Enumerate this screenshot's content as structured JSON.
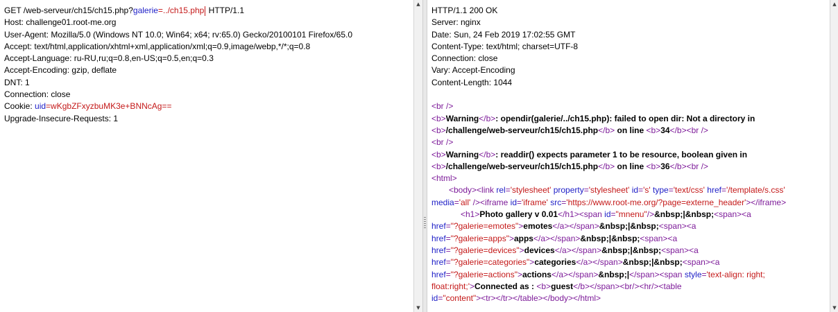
{
  "request": {
    "lines": [
      [
        {
          "t": "GET /web-serveur/ch15/ch15.php?",
          "c": "t"
        },
        {
          "t": "galerie",
          "c": "blue"
        },
        {
          "t": "=../ch15.php",
          "c": "red"
        },
        {
          "t": "",
          "c": "caret"
        },
        {
          "t": " HTTP/1.1",
          "c": "t"
        }
      ],
      [
        {
          "t": "Host: challenge01.root-me.org",
          "c": "t"
        }
      ],
      [
        {
          "t": "User-Agent: Mozilla/5.0 (Windows NT 10.0; Win64; x64; rv:65.0) Gecko/20100101 Firefox/65.0",
          "c": "t"
        }
      ],
      [
        {
          "t": "Accept: text/html,application/xhtml+xml,application/xml;q=0.9,image/webp,*/*;q=0.8",
          "c": "t"
        }
      ],
      [
        {
          "t": "Accept-Language: ru-RU,ru;q=0.8,en-US;q=0.5,en;q=0.3",
          "c": "t"
        }
      ],
      [
        {
          "t": "Accept-Encoding: gzip, deflate",
          "c": "t"
        }
      ],
      [
        {
          "t": "DNT: 1",
          "c": "t"
        }
      ],
      [
        {
          "t": "Connection: close",
          "c": "t"
        }
      ],
      [
        {
          "t": "Cookie: ",
          "c": "t"
        },
        {
          "t": "uid",
          "c": "blue"
        },
        {
          "t": "=wKgbZFxyzbuMK3e+BNNcAg==",
          "c": "red"
        }
      ],
      [
        {
          "t": "Upgrade-Insecure-Requests: 1",
          "c": "t"
        }
      ]
    ]
  },
  "response": {
    "lines": [
      [
        {
          "t": "HTTP/1.1 200 OK",
          "c": "t"
        }
      ],
      [
        {
          "t": "Server: nginx",
          "c": "t"
        }
      ],
      [
        {
          "t": "Date: Sun, 24 Feb 2019 17:02:55 GMT",
          "c": "t"
        }
      ],
      [
        {
          "t": "Content-Type: text/html; charset=UTF-8",
          "c": "t"
        }
      ],
      [
        {
          "t": "Connection: close",
          "c": "t"
        }
      ],
      [
        {
          "t": "Vary: Accept-Encoding",
          "c": "t"
        }
      ],
      [
        {
          "t": "Content-Length: 1044",
          "c": "t"
        }
      ],
      [],
      [
        {
          "t": "<br />",
          "c": "tag"
        }
      ],
      [
        {
          "t": "<b>",
          "c": "tag"
        },
        {
          "t": "Warning",
          "c": "bold"
        },
        {
          "t": "</b>",
          "c": "tag"
        },
        {
          "t": ":  opendir(galerie/../ch15.php): failed to open dir: Not a directory in",
          "c": "bold"
        }
      ],
      [
        {
          "t": "<b>",
          "c": "tag"
        },
        {
          "t": "/challenge/web-serveur/ch15/ch15.php",
          "c": "bold"
        },
        {
          "t": "</b>",
          "c": "tag"
        },
        {
          "t": " on line ",
          "c": "bold"
        },
        {
          "t": "<b>",
          "c": "tag"
        },
        {
          "t": "34",
          "c": "bold"
        },
        {
          "t": "</b><br />",
          "c": "tag"
        }
      ],
      [
        {
          "t": "<br />",
          "c": "tag"
        }
      ],
      [
        {
          "t": "<b>",
          "c": "tag"
        },
        {
          "t": "Warning",
          "c": "bold"
        },
        {
          "t": "</b>",
          "c": "tag"
        },
        {
          "t": ":  readdir() expects parameter 1 to be resource, boolean given in",
          "c": "bold"
        }
      ],
      [
        {
          "t": "<b>",
          "c": "tag"
        },
        {
          "t": "/challenge/web-serveur/ch15/ch15.php",
          "c": "bold"
        },
        {
          "t": "</b>",
          "c": "tag"
        },
        {
          "t": " on line ",
          "c": "bold"
        },
        {
          "t": "<b>",
          "c": "tag"
        },
        {
          "t": "36",
          "c": "bold"
        },
        {
          "t": "</b><br />",
          "c": "tag"
        }
      ],
      [
        {
          "t": "<html>",
          "c": "tag"
        }
      ],
      [
        {
          "t": "<body><link ",
          "c": "tag",
          "ind": 1
        },
        {
          "t": "rel",
          "c": "attr"
        },
        {
          "t": "=",
          "c": "tag"
        },
        {
          "t": "'stylesheet'",
          "c": "val"
        },
        {
          "t": " property",
          "c": "attr"
        },
        {
          "t": "=",
          "c": "tag"
        },
        {
          "t": "'stylesheet'",
          "c": "val"
        },
        {
          "t": " id",
          "c": "attr"
        },
        {
          "t": "=",
          "c": "tag"
        },
        {
          "t": "'s'",
          "c": "val"
        },
        {
          "t": " type",
          "c": "attr"
        },
        {
          "t": "=",
          "c": "tag"
        },
        {
          "t": "'text/css'",
          "c": "val"
        },
        {
          "t": " href",
          "c": "attr"
        },
        {
          "t": "=",
          "c": "tag"
        },
        {
          "t": "'/template/s.css'",
          "c": "val"
        }
      ],
      [
        {
          "t": "media",
          "c": "attr"
        },
        {
          "t": "=",
          "c": "tag"
        },
        {
          "t": "'all'",
          "c": "val"
        },
        {
          "t": " /><iframe ",
          "c": "tag"
        },
        {
          "t": "id",
          "c": "attr"
        },
        {
          "t": "=",
          "c": "tag"
        },
        {
          "t": "'iframe'",
          "c": "val"
        },
        {
          "t": " src",
          "c": "attr"
        },
        {
          "t": "=",
          "c": "tag"
        },
        {
          "t": "'https://www.root-me.org/?page=externe_header'",
          "c": "val"
        },
        {
          "t": "></iframe>",
          "c": "tag"
        }
      ],
      [
        {
          "t": "<h1>",
          "c": "tag",
          "ind": 2
        },
        {
          "t": "Photo gallery v 0.01",
          "c": "bold"
        },
        {
          "t": "</h1><span ",
          "c": "tag"
        },
        {
          "t": "id",
          "c": "attr"
        },
        {
          "t": "=",
          "c": "tag"
        },
        {
          "t": "\"mnenu\"",
          "c": "val"
        },
        {
          "t": "/>",
          "c": "tag"
        },
        {
          "t": "&nbsp;|&nbsp;",
          "c": "bold"
        },
        {
          "t": "<span><a",
          "c": "tag"
        }
      ],
      [
        {
          "t": "href",
          "c": "attr"
        },
        {
          "t": "=",
          "c": "tag"
        },
        {
          "t": "\"?galerie=emotes\"",
          "c": "val"
        },
        {
          "t": ">",
          "c": "tag"
        },
        {
          "t": "emotes",
          "c": "bold"
        },
        {
          "t": "</a></span>",
          "c": "tag"
        },
        {
          "t": "&nbsp;|&nbsp;",
          "c": "bold"
        },
        {
          "t": "<span><a",
          "c": "tag"
        }
      ],
      [
        {
          "t": "href",
          "c": "attr"
        },
        {
          "t": "=",
          "c": "tag"
        },
        {
          "t": "\"?galerie=apps\"",
          "c": "val"
        },
        {
          "t": ">",
          "c": "tag"
        },
        {
          "t": "apps",
          "c": "bold"
        },
        {
          "t": "</a></span>",
          "c": "tag"
        },
        {
          "t": "&nbsp;|&nbsp;",
          "c": "bold"
        },
        {
          "t": "<span><a",
          "c": "tag"
        }
      ],
      [
        {
          "t": "href",
          "c": "attr"
        },
        {
          "t": "=",
          "c": "tag"
        },
        {
          "t": "\"?galerie=devices\"",
          "c": "val"
        },
        {
          "t": ">",
          "c": "tag"
        },
        {
          "t": "devices",
          "c": "bold"
        },
        {
          "t": "</a></span>",
          "c": "tag"
        },
        {
          "t": "&nbsp;|&nbsp;",
          "c": "bold"
        },
        {
          "t": "<span><a",
          "c": "tag"
        }
      ],
      [
        {
          "t": "href",
          "c": "attr"
        },
        {
          "t": "=",
          "c": "tag"
        },
        {
          "t": "\"?galerie=categories\"",
          "c": "val"
        },
        {
          "t": ">",
          "c": "tag"
        },
        {
          "t": "categories",
          "c": "bold"
        },
        {
          "t": "</a></span>",
          "c": "tag"
        },
        {
          "t": "&nbsp;|&nbsp;",
          "c": "bold"
        },
        {
          "t": "<span><a",
          "c": "tag"
        }
      ],
      [
        {
          "t": "href",
          "c": "attr"
        },
        {
          "t": "=",
          "c": "tag"
        },
        {
          "t": "\"?galerie=actions\"",
          "c": "val"
        },
        {
          "t": ">",
          "c": "tag"
        },
        {
          "t": "actions",
          "c": "bold"
        },
        {
          "t": "</a></span>",
          "c": "tag"
        },
        {
          "t": "&nbsp;|",
          "c": "bold"
        },
        {
          "t": "</span><span ",
          "c": "tag"
        },
        {
          "t": "style",
          "c": "attr"
        },
        {
          "t": "=",
          "c": "tag"
        },
        {
          "t": "'text-align: right;",
          "c": "val"
        }
      ],
      [
        {
          "t": "float:right;'",
          "c": "val"
        },
        {
          "t": ">",
          "c": "tag"
        },
        {
          "t": "Connected as : ",
          "c": "bold"
        },
        {
          "t": "<b>",
          "c": "tag"
        },
        {
          "t": "guest",
          "c": "bold"
        },
        {
          "t": "</b></span><br/><hr/><table",
          "c": "tag"
        }
      ],
      [
        {
          "t": "id",
          "c": "attr"
        },
        {
          "t": "=",
          "c": "tag"
        },
        {
          "t": "\"content\"",
          "c": "val"
        },
        {
          "t": "><tr></tr></table></body></html>",
          "c": "tag"
        }
      ]
    ]
  }
}
